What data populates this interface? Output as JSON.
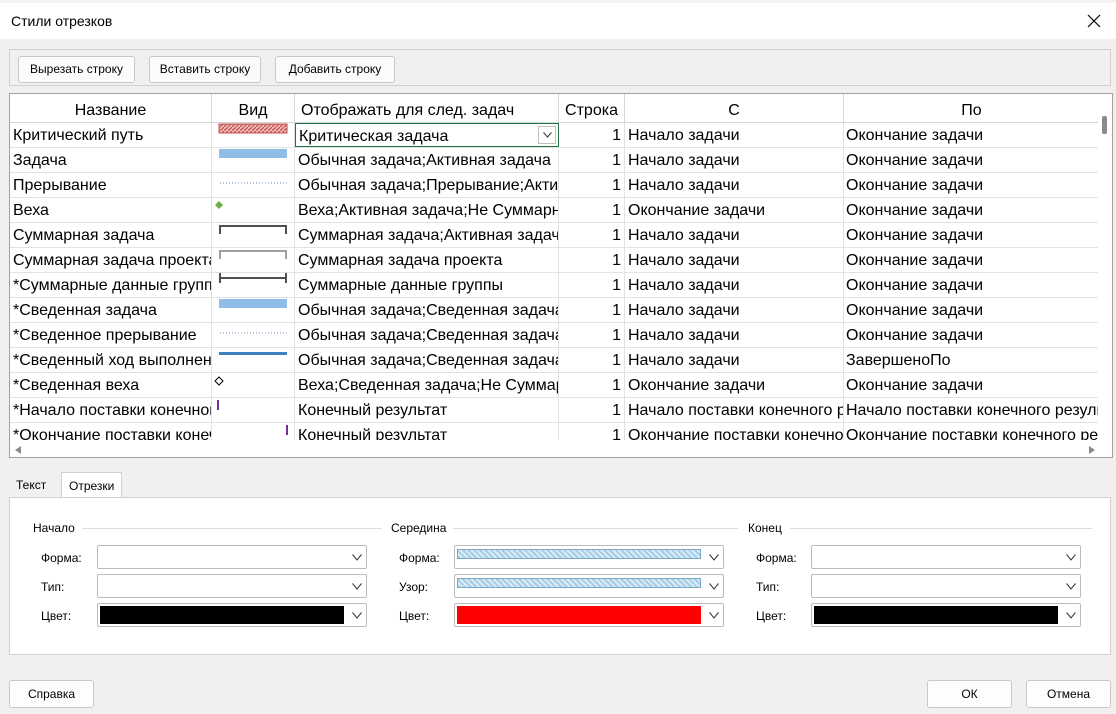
{
  "window": {
    "title": "Стили отрезков"
  },
  "toolbar": {
    "cut_label": "Вырезать строку",
    "paste_label": "Вставить строку",
    "add_label": "Добавить строку"
  },
  "grid": {
    "columns": [
      "Название",
      "Вид",
      "Отображать для след. задач",
      "Строка",
      "С",
      "По"
    ],
    "rows": [
      {
        "name": "Критический путь",
        "show_for": "Критическая задача",
        "row": "1",
        "from": "Начало задачи",
        "to": "Окончание задачи"
      },
      {
        "name": "Задача",
        "show_for": "Обычная задача;Активная задача",
        "row": "1",
        "from": "Начало задачи",
        "to": "Окончание задачи"
      },
      {
        "name": "Прерывание",
        "show_for": "Обычная задача;Прерывание;Активная задача",
        "row": "1",
        "from": "Начало задачи",
        "to": "Окончание задачи"
      },
      {
        "name": "Веха",
        "show_for": "Веха;Активная задача;Не Суммарная",
        "row": "1",
        "from": "Окончание задачи",
        "to": "Окончание задачи"
      },
      {
        "name": "Суммарная задача",
        "show_for": "Суммарная задача;Активная задача",
        "row": "1",
        "from": "Начало задачи",
        "to": "Окончание задачи"
      },
      {
        "name": "Суммарная задача проекта",
        "show_for": "Суммарная задача проекта",
        "row": "1",
        "from": "Начало задачи",
        "to": "Окончание задачи"
      },
      {
        "name": "*Суммарные данные группы",
        "show_for": "Суммарные данные группы",
        "row": "1",
        "from": "Начало задачи",
        "to": "Окончание задачи"
      },
      {
        "name": "*Сведенная задача",
        "show_for": "Обычная задача;Сведенная задача",
        "row": "1",
        "from": "Начало задачи",
        "to": "Окончание задачи"
      },
      {
        "name": "*Сведенное прерывание",
        "show_for": "Обычная задача;Сведенная задача",
        "row": "1",
        "from": "Начало задачи",
        "to": "Окончание задачи"
      },
      {
        "name": "*Сведенный ход выполнения",
        "show_for": "Обычная задача;Сведенная задача",
        "row": "1",
        "from": "Начало задачи",
        "to": "ЗавершеноПо"
      },
      {
        "name": "*Сведенная веха",
        "show_for": "Веха;Сведенная задача;Не Суммарная",
        "row": "1",
        "from": "Окончание задачи",
        "to": "Окончание задачи"
      },
      {
        "name": "*Начало поставки конечного результата",
        "show_for": "Конечный результат",
        "row": "1",
        "from": "Начало поставки конечного результата",
        "to": "Начало поставки конечного результата"
      },
      {
        "name": "*Окончание поставки конечного результата",
        "show_for": "Конечный результат",
        "row": "1",
        "from": "Окончание поставки конечного результата",
        "to": "Окончание поставки конечного результата"
      }
    ]
  },
  "tabs": [
    {
      "label": "Текст",
      "active": false
    },
    {
      "label": "Отрезки",
      "active": true
    }
  ],
  "panel": {
    "start": {
      "title": "Начало",
      "shape_label": "Форма:",
      "type_label": "Тип:",
      "color_label": "Цвет:",
      "color": "#000000"
    },
    "middle": {
      "title": "Середина",
      "shape_label": "Форма:",
      "pattern_label": "Узор:",
      "color_label": "Цвет:",
      "color": "#ff0000"
    },
    "end": {
      "title": "Конец",
      "shape_label": "Форма:",
      "type_label": "Тип:",
      "color_label": "Цвет:",
      "color": "#000000"
    }
  },
  "footer": {
    "help_label": "Справка",
    "ok_label": "ОК",
    "cancel_label": "Отмена"
  },
  "colors": {
    "task_blue": "#8fbde8",
    "summary_bar": "#505050",
    "critical_red": "#c0504d",
    "milestone_green": "#70ad47",
    "deliverable_purple": "#7030a0"
  }
}
